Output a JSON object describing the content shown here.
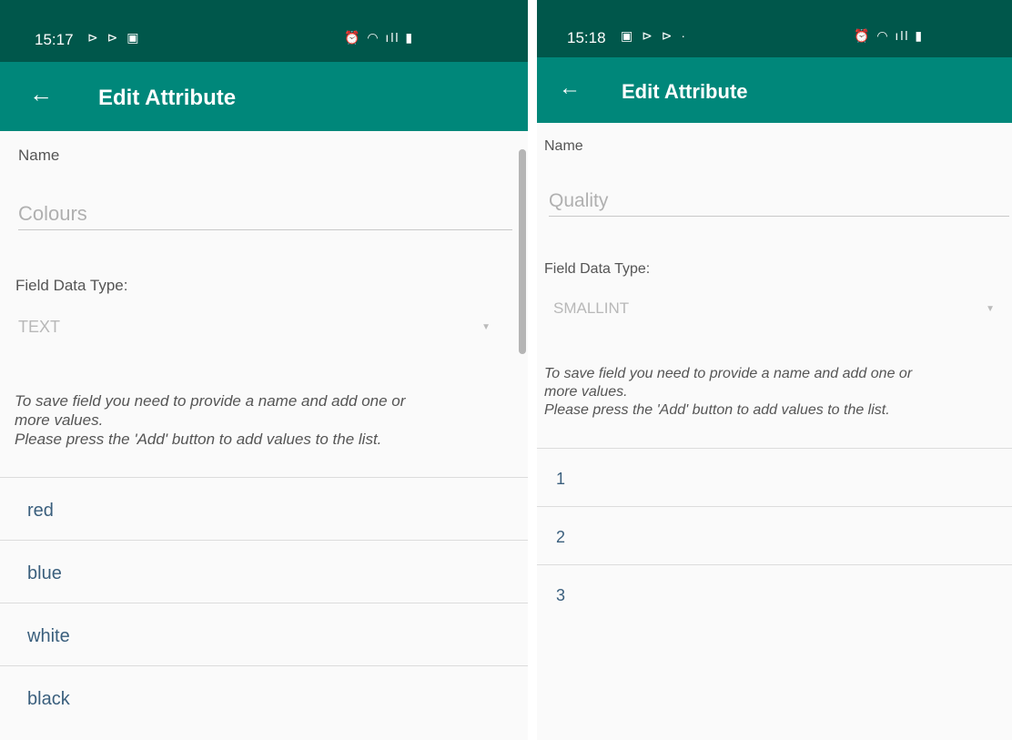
{
  "left": {
    "status": {
      "time": "15:17",
      "icons_left": "⊳ ⊳ ▣",
      "icons_right": "⏰ ◠ ıll ▮"
    },
    "app_bar": {
      "title": "Edit Attribute"
    },
    "name_label": "Name",
    "name_value": "Colours",
    "type_label": "Field Data Type:",
    "type_value": "TEXT",
    "helper_line1": "To save field you need to provide a name and add one or",
    "helper_line2": "more values.",
    "helper_line3": "Please press the 'Add' button to add values to the list.",
    "values": [
      "red",
      "blue",
      "white",
      "black"
    ]
  },
  "right": {
    "status": {
      "time": "15:18",
      "icons_left": "▣ ⊳ ⊳ ·",
      "icons_right": "⏰ ◠ ıll ▮"
    },
    "app_bar": {
      "title": "Edit Attribute"
    },
    "name_label": "Name",
    "name_value": "Quality",
    "type_label": "Field Data Type:",
    "type_value": "SMALLINT",
    "helper_line1": "To save field you need to provide a name and add one or",
    "helper_line2": "more values.",
    "helper_line3": "Please press the 'Add' button to add values to the list.",
    "values": [
      "1",
      "2",
      "3"
    ]
  },
  "colors": {
    "status_bar": "#00574b",
    "app_bar": "#00877a",
    "value_text": "#3a5f7d"
  },
  "icons": {
    "back": "arrow-left-icon",
    "dropdown": "triangle-down-icon"
  }
}
